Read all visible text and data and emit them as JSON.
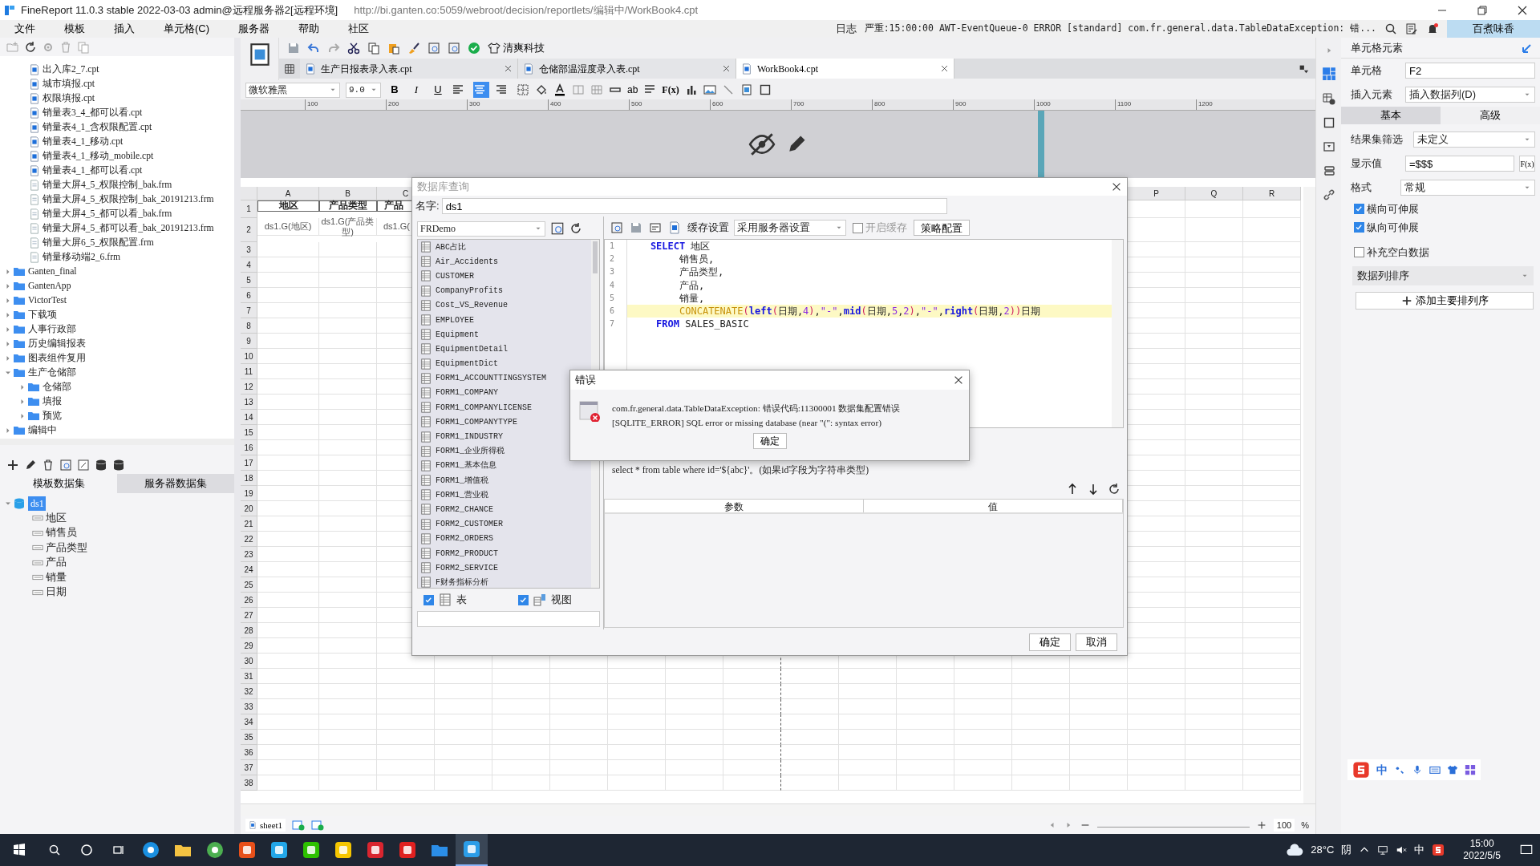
{
  "window": {
    "title": "FineReport 11.0.3 stable 2022-03-03 admin@远程服务器2[远程环境]",
    "url": "http://bi.ganten.co:5059/webroot/decision/reportlets/编辑中/WorkBook4.cpt"
  },
  "menu": [
    "文件",
    "模板",
    "插入",
    "单元格(C)",
    "服务器",
    "帮助",
    "社区"
  ],
  "log": {
    "label": "日志",
    "message": "严重:15:00:00 AWT-EventQueue-0 ERROR [standard] com.fr.general.data.TableDataException: 错..."
  },
  "user": "百煮味香",
  "file_tree": [
    {
      "children": [
        {
          "kind": "cpt",
          "name": "出入库2_7.cpt"
        },
        {
          "kind": "cpt",
          "name": "城市填报.cpt"
        },
        {
          "kind": "cpt",
          "name": "权限填报.cpt"
        },
        {
          "kind": "cpt",
          "name": "销量表3_4_都可以看.cpt"
        },
        {
          "kind": "cpt",
          "name": "销量表4_1_含权限配置.cpt"
        },
        {
          "kind": "cpt",
          "name": "销量表4_1_移动.cpt"
        },
        {
          "kind": "cpt",
          "name": "销量表4_1_移动_mobile.cpt"
        },
        {
          "kind": "cpt",
          "name": "销量表4_1_都可以看.cpt"
        },
        {
          "kind": "frm",
          "name": "销量大屏4_5_权限控制_bak.frm"
        },
        {
          "kind": "frm",
          "name": "销量大屏4_5_权限控制_bak_20191213.frm"
        },
        {
          "kind": "frm",
          "name": "销量大屏4_5_都可以看_bak.frm"
        },
        {
          "kind": "frm",
          "name": "销量大屏4_5_都可以看_bak_20191213.frm"
        },
        {
          "kind": "frm",
          "name": "销量大屏6_5_权限配置.frm"
        },
        {
          "kind": "frm",
          "name": "销量移动端2_6.frm"
        }
      ]
    },
    {
      "kind": "folder",
      "name": "Ganten_final",
      "expanded": false
    },
    {
      "kind": "folder",
      "name": "GantenApp",
      "expanded": false
    },
    {
      "kind": "folder",
      "name": "VictorTest",
      "expanded": false
    },
    {
      "kind": "folder",
      "name": "下载项",
      "expanded": false
    },
    {
      "kind": "folder",
      "name": "人事行政部",
      "expanded": false
    },
    {
      "kind": "folder",
      "name": "历史编辑报表",
      "expanded": false
    },
    {
      "kind": "folder",
      "name": "图表组件复用",
      "expanded": false
    },
    {
      "kind": "folder",
      "name": "生产仓储部",
      "expanded": true,
      "children": [
        {
          "kind": "folder",
          "name": "仓储部",
          "expanded": false
        },
        {
          "kind": "folder",
          "name": "填报",
          "expanded": false
        },
        {
          "kind": "folder",
          "name": "预览",
          "expanded": false
        }
      ]
    },
    {
      "kind": "folder",
      "name": "编辑中",
      "expanded": false
    }
  ],
  "dataset_tabs": [
    {
      "label": "模板数据集",
      "selected": true
    },
    {
      "label": "服务器数据集",
      "selected": false
    }
  ],
  "datasets": [
    {
      "name": "ds1",
      "selected": true,
      "expanded": true,
      "children": [
        {
          "name": "地区"
        },
        {
          "name": "销售员"
        },
        {
          "name": "产品类型"
        },
        {
          "name": "产品"
        },
        {
          "name": "销量"
        },
        {
          "name": "日期"
        }
      ]
    }
  ],
  "brand_button": "清爽科技",
  "template_tabs": [
    {
      "label": "生产日报表录入表.cpt",
      "selected": false
    },
    {
      "label": "仓储部温湿度录入表.cpt",
      "selected": false
    },
    {
      "label": "WorkBook4.cpt",
      "selected": true
    }
  ],
  "format_bar": {
    "font": "微软雅黑",
    "size": "9.0",
    "style_buttons": [
      "B",
      "I",
      "U"
    ],
    "align": [
      {
        "selected": false
      },
      {
        "selected": true
      },
      {
        "selected": false
      }
    ],
    "tool_labels": [
      "ab",
      "F(x)"
    ]
  },
  "ruler": [
    "100",
    "200",
    "300",
    "400",
    "500",
    "600",
    "700",
    "800",
    "900",
    "1000",
    "1100",
    "1200"
  ],
  "grid": {
    "columns": [
      "A",
      "B",
      "C",
      "P",
      "Q",
      "R"
    ],
    "rows": [
      {
        "number": "1",
        "cells": [
          "地区",
          "产品类型",
          "产品"
        ]
      },
      {
        "number": "2",
        "cells": [
          "ds1.G(地区)",
          "ds1.G(产品类型)",
          "ds1.G("
        ]
      },
      {
        "number": "3"
      },
      {
        "number": "4"
      },
      {
        "number": "5"
      },
      {
        "number": "6"
      },
      {
        "number": "7"
      },
      {
        "number": "8"
      },
      {
        "number": "9"
      },
      {
        "number": "10"
      },
      {
        "number": "11"
      },
      {
        "number": "12"
      },
      {
        "number": "13"
      },
      {
        "number": "14"
      },
      {
        "number": "15"
      },
      {
        "number": "16"
      },
      {
        "number": "17"
      },
      {
        "number": "18"
      },
      {
        "number": "19"
      },
      {
        "number": "20"
      },
      {
        "number": "21"
      },
      {
        "number": "22"
      },
      {
        "number": "23"
      },
      {
        "number": "24"
      },
      {
        "number": "25"
      },
      {
        "number": "26"
      },
      {
        "number": "27"
      },
      {
        "number": "28"
      },
      {
        "number": "29"
      },
      {
        "number": "30"
      },
      {
        "number": "31"
      },
      {
        "number": "32"
      },
      {
        "number": "33"
      },
      {
        "number": "34"
      },
      {
        "number": "35"
      },
      {
        "number": "36"
      },
      {
        "number": "37"
      },
      {
        "number": "38"
      }
    ]
  },
  "sheets": [
    {
      "label": "sheet1",
      "selected": true
    }
  ],
  "zoom": {
    "value": "100",
    "unit": "%"
  },
  "side_panel": {
    "title": "单元格元素",
    "properties": [
      {
        "kind": "input",
        "label": "单元格",
        "value": "F2"
      },
      {
        "kind": "select",
        "label": "插入元素",
        "value": "插入数据列(D)"
      }
    ],
    "tabs": [
      {
        "label": "基本",
        "selected": true
      },
      {
        "label": "高级",
        "selected": false
      }
    ],
    "settings": [
      {
        "kind": "select",
        "label": "结果集筛选",
        "value": "未定义"
      },
      {
        "kind": "formula",
        "label": "显示值",
        "value": "=$$$",
        "button": "F(x)"
      },
      {
        "kind": "select",
        "label": "格式",
        "value": "常规"
      }
    ],
    "options": [
      {
        "label": "横向可伸展",
        "checked": true
      },
      {
        "label": "纵向可伸展",
        "checked": true
      },
      {
        "label": "补充空白数据",
        "checked": false
      }
    ],
    "sort_label": "数据列排序",
    "add_sort": "添加主要排列序"
  },
  "db_dialog": {
    "title": "数据库查询",
    "name_label": "名字:",
    "name": "ds1",
    "source": "FRDemo",
    "tables": [
      "ABC占比",
      "Air_Accidents",
      "CUSTOMER",
      "CompanyProfits",
      "Cost_VS_Revenue",
      "EMPLOYEE",
      "Equipment",
      "EquipmentDetail",
      "EquipmentDict",
      "FORM1_ACCOUNTTINGSYSTEM",
      "FORM1_COMPANY",
      "FORM1_COMPANYLICENSE",
      "FORM1_COMPANYTYPE",
      "FORM1_INDUSTRY",
      "FORM1_企业所得税",
      "FORM1_基本信息",
      "FORM1_增值税",
      "FORM1_营业税",
      "FORM2_CHANCE",
      "FORM2_CUSTOMER",
      "FORM2_ORDERS",
      "FORM2_PRODUCT",
      "FORM2_SERVICE",
      "F财务指标分析"
    ],
    "filters": [
      {
        "label": "表",
        "checked": true
      },
      {
        "label": "视图",
        "checked": true
      }
    ],
    "cache_label": "缓存设置",
    "cache_mode": "采用服务器设置",
    "enable_cache": {
      "label": "开启缓存",
      "checked": false
    },
    "strategy": "策略配置",
    "sql": [
      {
        "number": "1",
        "highlighted": false,
        "tokens": [
          {
            "kind": "keyword",
            "text": "    SELECT"
          },
          {
            "kind": "plain",
            "text": " 地区"
          }
        ]
      },
      {
        "number": "2",
        "highlighted": false,
        "tokens": [
          {
            "kind": "plain",
            "text": "         销售员,"
          }
        ]
      },
      {
        "number": "3",
        "highlighted": false,
        "tokens": [
          {
            "kind": "plain",
            "text": "         产品类型,"
          }
        ]
      },
      {
        "number": "4",
        "highlighted": false,
        "tokens": [
          {
            "kind": "plain",
            "text": "         产品,"
          }
        ]
      },
      {
        "number": "5",
        "highlighted": false,
        "tokens": [
          {
            "kind": "plain",
            "text": "         销量,"
          }
        ]
      },
      {
        "number": "6",
        "highlighted": true,
        "tokens": [
          {
            "kind": "function",
            "text": "         CONCATENATE"
          },
          {
            "kind": "bracket",
            "text": "("
          },
          {
            "kind": "keyword",
            "text": "left"
          },
          {
            "kind": "bracket",
            "text": "("
          },
          {
            "kind": "plain",
            "text": "日期,"
          },
          {
            "kind": "literal",
            "text": "4"
          },
          {
            "kind": "bracket",
            "text": ")"
          },
          {
            "kind": "plain",
            "text": ","
          },
          {
            "kind": "literal",
            "text": "\"-\""
          },
          {
            "kind": "plain",
            "text": ","
          },
          {
            "kind": "keyword",
            "text": "mid"
          },
          {
            "kind": "bracket",
            "text": "("
          },
          {
            "kind": "plain",
            "text": "日期,"
          },
          {
            "kind": "literal",
            "text": "5"
          },
          {
            "kind": "plain",
            "text": ","
          },
          {
            "kind": "literal",
            "text": "2"
          },
          {
            "kind": "bracket",
            "text": ")"
          },
          {
            "kind": "plain",
            "text": ","
          },
          {
            "kind": "literal",
            "text": "\"-\""
          },
          {
            "kind": "plain",
            "text": ","
          },
          {
            "kind": "keyword",
            "text": "right"
          },
          {
            "kind": "bracket",
            "text": "("
          },
          {
            "kind": "plain",
            "text": "日期,"
          },
          {
            "kind": "literal",
            "text": "2"
          },
          {
            "kind": "bracket",
            "text": "))"
          },
          {
            "kind": "plain",
            "text": "日期"
          }
        ]
      },
      {
        "number": "7",
        "highlighted": false,
        "tokens": [
          {
            "kind": "keyword",
            "text": "     FROM"
          },
          {
            "kind": "plain",
            "text": " SALES_BASIC"
          }
        ]
      }
    ],
    "hint": "select * from table where id='${abc}'。(如果id字段为字符串类型)",
    "param_columns": [
      "参数",
      "值"
    ],
    "buttons": [
      "确定",
      "取消"
    ]
  },
  "error_dialog": {
    "title": "错误",
    "lines": [
      "com.fr.general.data.TableDataException: 错误代码:11300001 数据集配置错误",
      "[SQLITE_ERROR] SQL error or missing database (near \"(\": syntax error)"
    ],
    "button": "确定"
  },
  "ime_bar": {
    "mode": "中"
  },
  "taskbar": {
    "weather": "28°C",
    "sky": "阴",
    "input_mode": "中",
    "time": "15:00",
    "date": "2022/5/5"
  }
}
